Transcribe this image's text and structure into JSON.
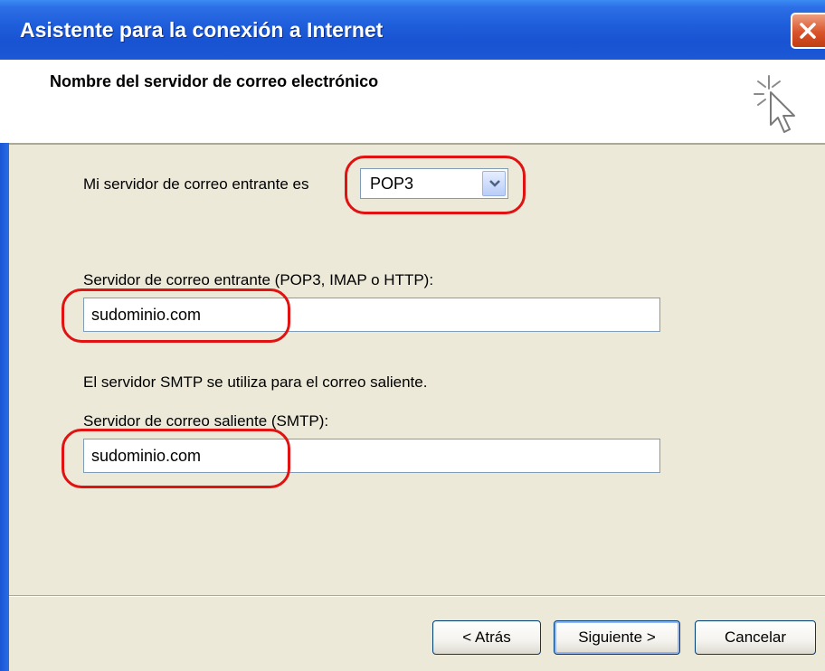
{
  "window": {
    "title": "Asistente para la conexión a Internet",
    "close_icon": "close-icon"
  },
  "header": {
    "title": "Nombre del servidor de correo electrónico",
    "icon": "wizard-cursor-icon"
  },
  "form": {
    "server_type_label": "Mi servidor de correo entrante es",
    "server_type_value": "POP3",
    "incoming_label": "Servidor de correo entrante (POP3, IMAP o HTTP):",
    "incoming_value": "sudominio.com",
    "smtp_info": "El servidor SMTP se utiliza para el correo saliente.",
    "outgoing_label": "Servidor de correo saliente (SMTP):",
    "outgoing_value": "sudominio.com"
  },
  "buttons": {
    "back": "< Atrás",
    "next": "Siguiente >",
    "cancel": "Cancelar"
  },
  "colors": {
    "titlebar": "#1f5fdc",
    "dialog_background": "#ece9d8",
    "highlight": "#e01212"
  }
}
